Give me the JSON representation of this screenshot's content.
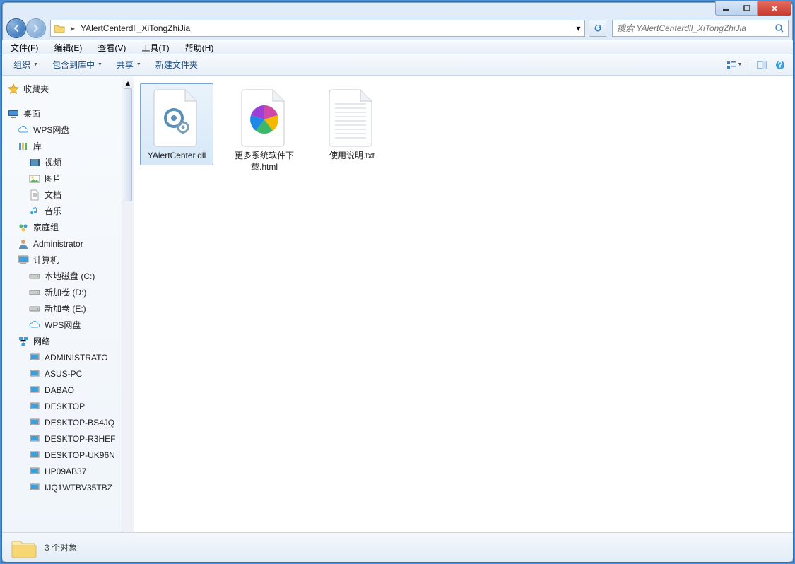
{
  "windowControls": {
    "min": "minimize",
    "max": "maximize",
    "close": "close"
  },
  "nav": {
    "path": "YAlertCenterdll_XiTongZhiJia",
    "searchPlaceholder": "搜索 YAlertCenterdll_XiTongZhiJia"
  },
  "menu": [
    {
      "label": "文件(F)"
    },
    {
      "label": "编辑(E)"
    },
    {
      "label": "查看(V)"
    },
    {
      "label": "工具(T)"
    },
    {
      "label": "帮助(H)"
    }
  ],
  "toolbar": {
    "organize": "组织",
    "includeLib": "包含到库中",
    "share": "共享",
    "newFolder": "新建文件夹"
  },
  "sidebar": {
    "favorites": "收藏夹",
    "desktop": "桌面",
    "wps": "WPS网盘",
    "libraries": "库",
    "videos": "视频",
    "pictures": "图片",
    "documents": "文档",
    "music": "音乐",
    "homegroup": "家庭组",
    "admin": "Administrator",
    "computer": "计算机",
    "localC": "本地磁盘 (C:)",
    "diskD": "新加卷 (D:)",
    "diskE": "新加卷 (E:)",
    "wps2": "WPS网盘",
    "network": "网络",
    "n1": "ADMINISTRATO",
    "n2": "ASUS-PC",
    "n3": "DABAO",
    "n4": "DESKTOP",
    "n5": "DESKTOP-BS4JQ",
    "n6": "DESKTOP-R3HEF",
    "n7": "DESKTOP-UK96N",
    "n8": "HP09AB37",
    "n9": "IJQ1WTBV35TBZ"
  },
  "files": [
    {
      "label": "YAlertCenter.dll",
      "icon": "dll",
      "selected": true
    },
    {
      "label": "更多系统软件下载.html",
      "icon": "html",
      "selected": false
    },
    {
      "label": "使用说明.txt",
      "icon": "txt",
      "selected": false
    }
  ],
  "status": {
    "count": "3 个对象"
  }
}
